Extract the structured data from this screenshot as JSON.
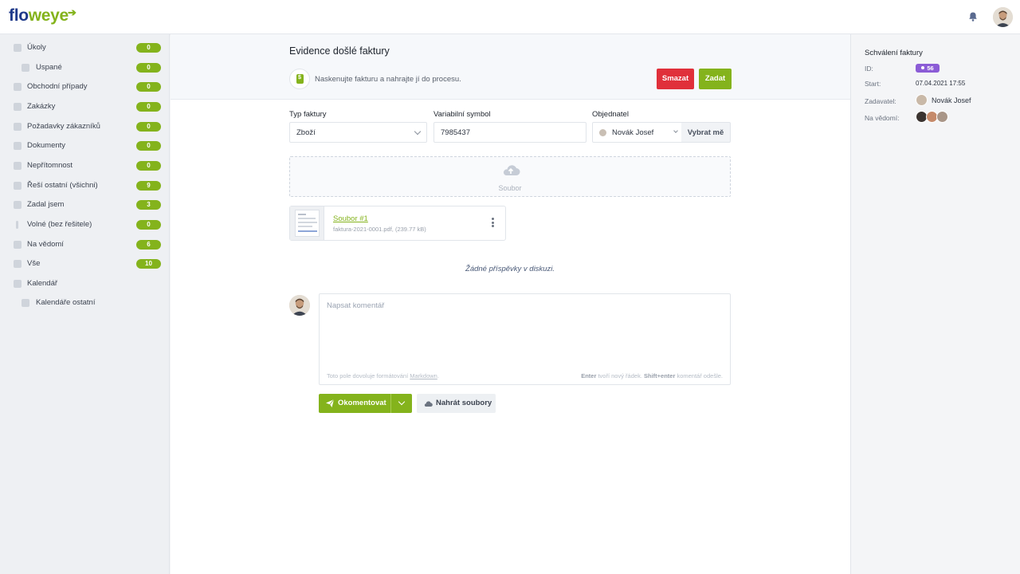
{
  "app": {
    "logo_part1": "flo",
    "logo_part2": "weye"
  },
  "sidebar": {
    "items": [
      {
        "label": "Úkoly",
        "count": "0",
        "icon": "bell-icon"
      },
      {
        "label": "Uspané",
        "count": "0",
        "icon": "sleep-icon"
      },
      {
        "label": "Obchodní případy",
        "count": "0",
        "icon": "briefcase-icon"
      },
      {
        "label": "Zakázky",
        "count": "0",
        "icon": "car-icon"
      },
      {
        "label": "Požadavky zákazníků",
        "count": "0",
        "icon": "chat-icon"
      },
      {
        "label": "Dokumenty",
        "count": "0",
        "icon": "documents-icon"
      },
      {
        "label": "Nepřítomnost",
        "count": "0",
        "icon": "calendar-off-icon"
      },
      {
        "label": "Řeší ostatní (všichni)",
        "count": "9",
        "icon": "toolbox-icon"
      },
      {
        "label": "Zadal jsem",
        "count": "3",
        "icon": "clipboard-icon"
      },
      {
        "label": "Volné (bez řešitele)",
        "count": "0",
        "icon": "exclamation-icon"
      },
      {
        "label": "Na vědomí",
        "count": "6",
        "icon": "home-icon"
      },
      {
        "label": "Vše",
        "count": "10",
        "icon": "folder-icon"
      },
      {
        "label": "Kalendář",
        "count": "",
        "icon": "calendar-icon"
      },
      {
        "label": "Kalendáře ostatní",
        "count": "",
        "icon": "calendar-icon"
      }
    ]
  },
  "main": {
    "title": "Evidence došlé faktury",
    "info_text": "Naskenujte fakturu a nahrajte jí do procesu.",
    "delete_label": "Smazat",
    "submit_label": "Zadat",
    "fields": {
      "invoice_type_label": "Typ faktury",
      "invoice_type_value": "Zboží",
      "variable_symbol_label": "Variabilní symbol",
      "variable_symbol_value": "7985437",
      "orderer_label": "Objednatel",
      "orderer_value": "Novák Josef",
      "pick_me_label": "Vybrat mě"
    },
    "dropzone_label": "Soubor",
    "file": {
      "name": "Soubor #1",
      "meta": "faktura-2021-0001.pdf, (239.77 kB)"
    },
    "no_posts": "Žádné příspěvky v diskuzi.",
    "comment": {
      "placeholder": "Napsat komentář",
      "hint_left_prefix": "Toto pole dovoluje formátování ",
      "hint_left_link": "Markdown",
      "hint_left_suffix": ".",
      "hint_right_enter": "Enter",
      "hint_right_enter_text": " tvoří nový řádek. ",
      "hint_right_shift": "Shift+enter",
      "hint_right_shift_text": " komentář odešle."
    },
    "comment_button": "Okomentovat",
    "upload_button": "Nahrát soubory"
  },
  "right_panel": {
    "title": "Schválení faktury",
    "id_key": "ID:",
    "id_value": "56",
    "start_key": "Start:",
    "start_value": "07.04.2021 17:55",
    "assigner_key": "Zadavatel:",
    "assigner_value": "Novák Josef",
    "watchers_key": "Na vědomí:"
  },
  "colors": {
    "accent_green": "#84b31c",
    "danger_red": "#e0303a",
    "logo_blue": "#1f3a8a",
    "id_badge_purple": "#8b5cd6"
  }
}
